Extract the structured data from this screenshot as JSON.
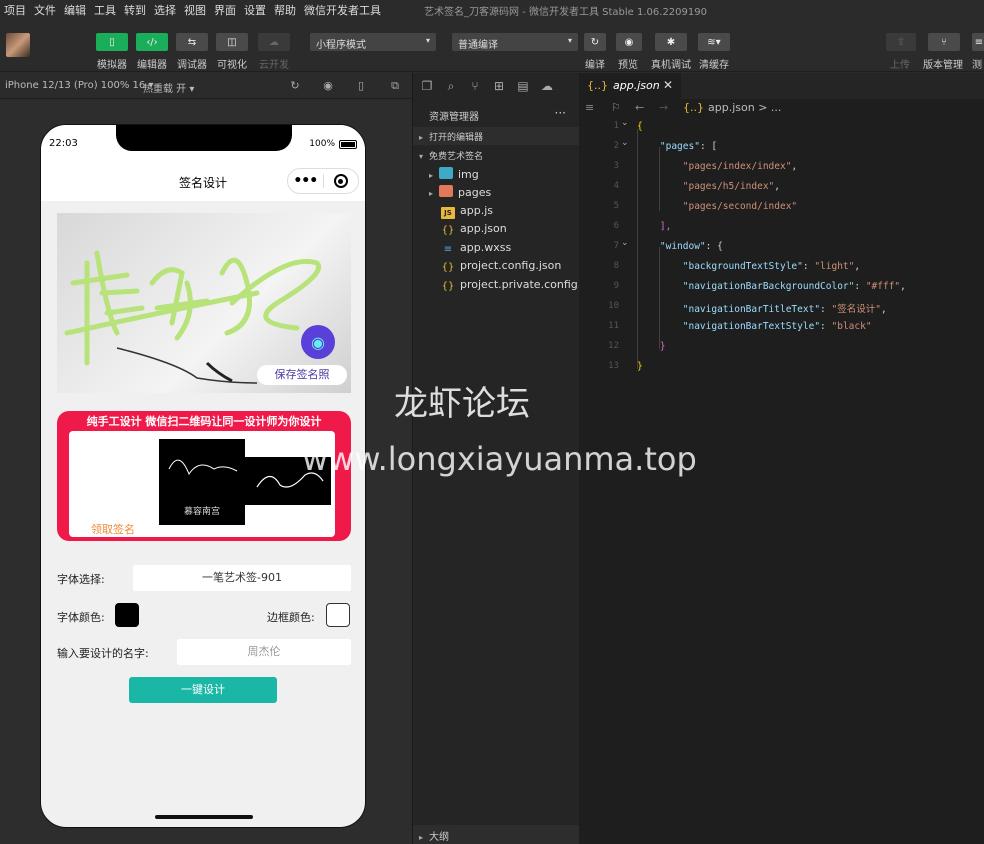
{
  "menu": [
    "项目",
    "文件",
    "编辑",
    "工具",
    "转到",
    "选择",
    "视图",
    "界面",
    "设置",
    "帮助",
    "微信开发者工具"
  ],
  "window_title": "艺术签名_刀客源码网 - 微信开发者工具 Stable 1.06.2209190",
  "toolbar": {
    "simulator": "模拟器",
    "editor": "编辑器",
    "debugger": "调试器",
    "visual": "可视化",
    "cloud": "云开发",
    "mode_select": "小程序模式",
    "compile_select": "普通编译",
    "compile": "编译",
    "preview": "预览",
    "real_debug": "真机调试",
    "clear_cache": "清缓存",
    "upload": "上传",
    "version_mgmt": "版本管理",
    "test": "测"
  },
  "simbar": {
    "device": "iPhone 12/13 (Pro) 100% 16 ▾",
    "hot_reload": "热重载 开 ▾"
  },
  "phone": {
    "time": "22:03",
    "battery": "100%",
    "nav_title": "签名设计",
    "save_photo": "保存签名照",
    "red_title": "纯手工设计 微信扫二维码让同一设计师为你设计",
    "sample_name": "慕容南宫",
    "get_signature": "领取签名",
    "font_label": "字体选择:",
    "font_value": "一笔艺术签-901",
    "font_color_label": "字体颜色:",
    "border_color_label": "边框颜色:",
    "name_label": "输入要设计的名字:",
    "name_placeholder": "周杰伦",
    "design_button": "一键设计",
    "font_color": "#000000",
    "border_color": "#ffffff"
  },
  "explorer": {
    "header": "资源管理器",
    "open_editors": "打开的编辑器",
    "project": "免费艺术签名",
    "items": [
      "img",
      "pages",
      "app.js",
      "app.json",
      "app.wxss",
      "project.config.json",
      "project.private.config.js..."
    ],
    "outline": "大纲"
  },
  "editor": {
    "tab": "app.json",
    "breadcrumb": "app.json > ...",
    "line_numbers": [
      "1",
      "2",
      "3",
      "4",
      "5",
      "6",
      "7",
      "8",
      "9",
      "10",
      "11",
      "12",
      "13"
    ],
    "code": {
      "l1": "{",
      "l2k": "\"pages\"",
      "l2p": ": [",
      "l3": "\"pages/index/index\"",
      "l4": "\"pages/h5/index\"",
      "l5": "\"pages/second/index\"",
      "l6": "],",
      "l7k": "\"window\"",
      "l7p": ": {",
      "l8k": "\"backgroundTextStyle\"",
      "l8v": "\"light\"",
      "l9k": "\"navigationBarBackgroundColor\"",
      "l9v": "\"#fff\"",
      "l10k": "\"navigationBarTitleText\"",
      "l10v": "\"签名设计\"",
      "l11k": "\"navigationBarTextStyle\"",
      "l11v": "\"black\"",
      "l12": "}",
      "l13": "}"
    }
  },
  "watermark": {
    "line1": "龙虾论坛",
    "line2": "www.longxiayuanma.top"
  }
}
